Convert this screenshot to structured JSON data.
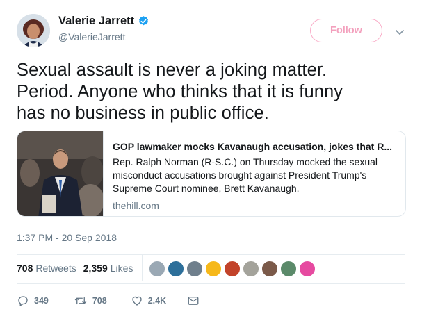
{
  "author": {
    "name": "Valerie Jarrett",
    "handle": "@ValerieJarrett",
    "verified_icon": "verified-badge-icon"
  },
  "follow_button": {
    "label": "Follow"
  },
  "tweet": {
    "lines": [
      "Sexual assault is never a joking matter.",
      "Period.  Anyone who thinks that it is funny",
      "has no business in public office."
    ]
  },
  "card": {
    "title": "GOP lawmaker mocks Kavanaugh accusation, jokes that R...",
    "description": "Rep. Ralph Norman (R-S.C.) on Thursday mocked the sexual misconduct accusations brought against President Trump's Supreme Court nominee, Brett Kavanaugh.",
    "domain": "thehill.com"
  },
  "timestamp": "1:37 PM - 20 Sep 2018",
  "stats": {
    "retweets_count": "708",
    "retweets_label": "Retweets",
    "likes_count": "2,359",
    "likes_label": "Likes"
  },
  "liker_avatars": [
    "#9aa8b4",
    "#2d6f9a",
    "#6f7f8c",
    "#f6b81a",
    "#c2432a",
    "#a4a39b",
    "#7b5a4a",
    "#5b8a6a",
    "#e64aa0"
  ],
  "actions": {
    "replies": "349",
    "retweets": "708",
    "likes": "2.4K"
  },
  "colors": {
    "accent_pink": "#f3a0bd",
    "verified_blue": "#1da1f2",
    "muted": "#657786"
  }
}
